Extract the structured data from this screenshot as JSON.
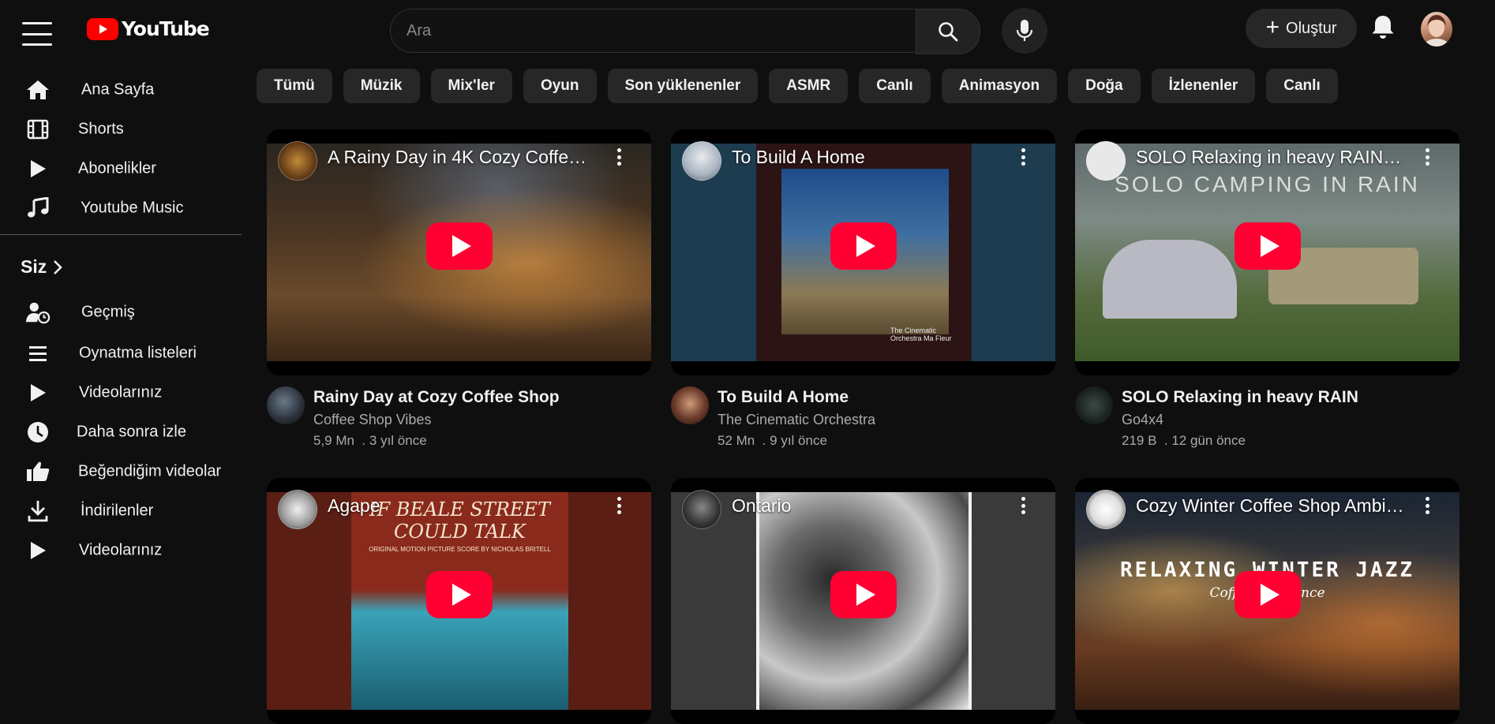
{
  "header": {
    "logo_text": "YouTube",
    "search_placeholder": "Ara",
    "create_label": "Oluştur"
  },
  "sidebar": {
    "main": [
      {
        "label": "Ana Sayfa",
        "icon": "home-icon"
      },
      {
        "label": "Shorts",
        "icon": "shorts-icon"
      },
      {
        "label": "Abonelikler",
        "icon": "subscriptions-icon"
      },
      {
        "label": "Youtube Music",
        "icon": "music-icon"
      }
    ],
    "you_label": "Siz",
    "you": [
      {
        "label": "Geçmiş",
        "icon": "history-icon"
      },
      {
        "label": "Oynatma listeleri",
        "icon": "playlists-icon"
      },
      {
        "label": "Videolarınız",
        "icon": "your-videos-icon"
      },
      {
        "label": "Daha sonra izle",
        "icon": "watch-later-icon"
      },
      {
        "label": "Beğendiğim videolar",
        "icon": "liked-videos-icon"
      },
      {
        "label": "İndirilenler",
        "icon": "downloads-icon"
      },
      {
        "label": "Videolarınız",
        "icon": "your-videos-icon"
      }
    ]
  },
  "chips": [
    "Tümü",
    "Müzik",
    "Mix'ler",
    "Oyun",
    "Son yüklenenler",
    "ASMR",
    "Canlı",
    "Animasyon",
    "Doğa",
    "İzlenenler",
    "Canlı"
  ],
  "videos": [
    {
      "thumb_title": "A Rainy Day in 4K Cozy Coffee S...",
      "title": "Rainy Day at Cozy Coffee Shop",
      "channel": "Coffee Shop Vibes",
      "views": "5,9 Mn",
      "age": "3 yıl önce"
    },
    {
      "thumb_title": "To Build A Home",
      "title": "To Build A Home",
      "channel": "The Cinematic Orchestra",
      "views": "52 Mn",
      "age": "9 yıl önce"
    },
    {
      "thumb_title": "SOLO Relaxing in heavy RAIN [ ...",
      "title": "SOLO Relaxing in heavy RAIN",
      "channel": "Go4x4",
      "views": "219 B",
      "age": "12 gün önce"
    },
    {
      "thumb_title": "Agape",
      "title": "",
      "channel": "",
      "views": "",
      "age": ""
    },
    {
      "thumb_title": "Ontario",
      "title": "",
      "channel": "",
      "views": "",
      "age": ""
    },
    {
      "thumb_title": "Cozy Winter Coffee Shop Ambie...",
      "title": "",
      "channel": "",
      "views": "",
      "age": ""
    }
  ],
  "thumb_text": {
    "video2_cover": "The Cinematic Orchestra Ma Fleur",
    "video3_overlay": "SOLO CAMPING IN RAIN",
    "video4_cover": "IF BEALE STREET COULD TALK",
    "video4_cover_sub": "ORIGINAL MOTION PICTURE SCORE BY NICHOLAS BRITELL",
    "video6_overlay": "RELAXING WINTER JAZZ",
    "video6_overlay_sub": "Coffee Ambience"
  },
  "colors": {
    "background": "#0f0f0f",
    "chip": "#272727",
    "play_button": "#ff0033",
    "logo_red": "#ff0000"
  }
}
